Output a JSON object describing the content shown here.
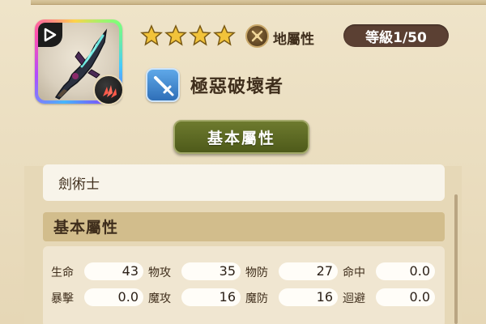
{
  "weapon": {
    "name": "極惡破壞者",
    "stars": 4,
    "element_label": "地屬性",
    "level_text": "等級1/50",
    "type_icon": "sword-type-icon",
    "badge_icon": "fire-claw-icon"
  },
  "tab": {
    "label": "基本屬性"
  },
  "info": {
    "class_label": "劍術士"
  },
  "section": {
    "title": "基本屬性"
  },
  "stats": {
    "hp_label": "生命",
    "hp_value": "43",
    "patk_label": "物攻",
    "patk_value": "35",
    "pdef_label": "物防",
    "pdef_value": "27",
    "acc_label": "命中",
    "acc_value": "0.0",
    "crit_label": "暴擊",
    "crit_value": "0.0",
    "matk_label": "魔攻",
    "matk_value": "16",
    "mdef_label": "魔防",
    "mdef_value": "16",
    "eva_label": "迴避",
    "eva_value": "0.0"
  },
  "colors": {
    "level_pill": "#5b4033",
    "tab_button": "#5a6624",
    "type_icon": "#3f83cf",
    "star": "#f2c33a"
  }
}
